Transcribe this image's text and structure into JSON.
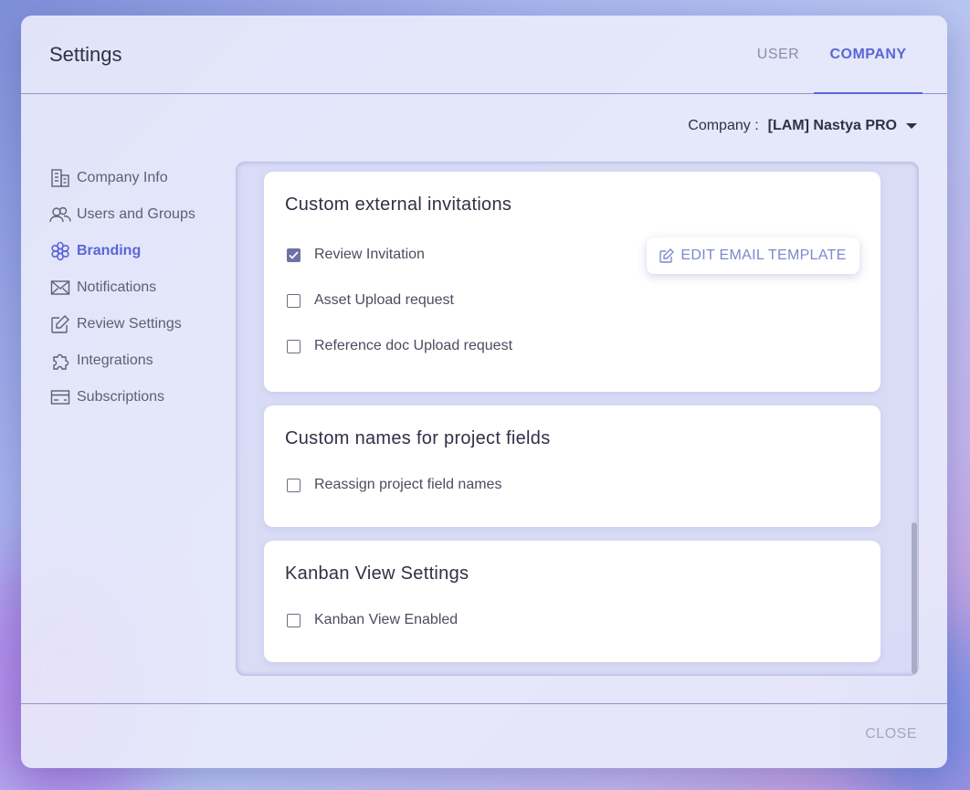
{
  "window": {
    "title": "Settings",
    "tabs": [
      {
        "label": "USER",
        "active": false
      },
      {
        "label": "COMPANY",
        "active": true
      }
    ]
  },
  "company_selector": {
    "label": "Company :",
    "value": "[LAM] Nastya PRO"
  },
  "sidebar": {
    "items": [
      {
        "label": "Company Info",
        "icon": "building-icon",
        "active": false
      },
      {
        "label": "Users and Groups",
        "icon": "users-icon",
        "active": false
      },
      {
        "label": "Branding",
        "icon": "flower-icon",
        "active": true
      },
      {
        "label": "Notifications",
        "icon": "envelope-icon",
        "active": false
      },
      {
        "label": "Review Settings",
        "icon": "edit-icon",
        "active": false
      },
      {
        "label": "Integrations",
        "icon": "puzzle-icon",
        "active": false
      },
      {
        "label": "Subscriptions",
        "icon": "card-icon",
        "active": false
      }
    ]
  },
  "cards": {
    "invitations": {
      "title": "Custom external invitations",
      "options": [
        {
          "label": "Review Invitation",
          "checked": true
        },
        {
          "label": "Asset Upload request",
          "checked": false
        },
        {
          "label": "Reference doc Upload request",
          "checked": false
        }
      ],
      "edit_button": "EDIT EMAIL TEMPLATE"
    },
    "project_fields": {
      "title": "Custom names for project fields",
      "options": [
        {
          "label": "Reassign project field names",
          "checked": false
        }
      ]
    },
    "kanban": {
      "title": "Kanban View Settings",
      "options": [
        {
          "label": "Kanban View Enabled",
          "checked": false
        }
      ]
    }
  },
  "footer": {
    "close_label": "CLOSE"
  },
  "colors": {
    "accent": "#5a66d6",
    "checkbox_checked": "#6d72a5",
    "text": "#2f3145"
  }
}
